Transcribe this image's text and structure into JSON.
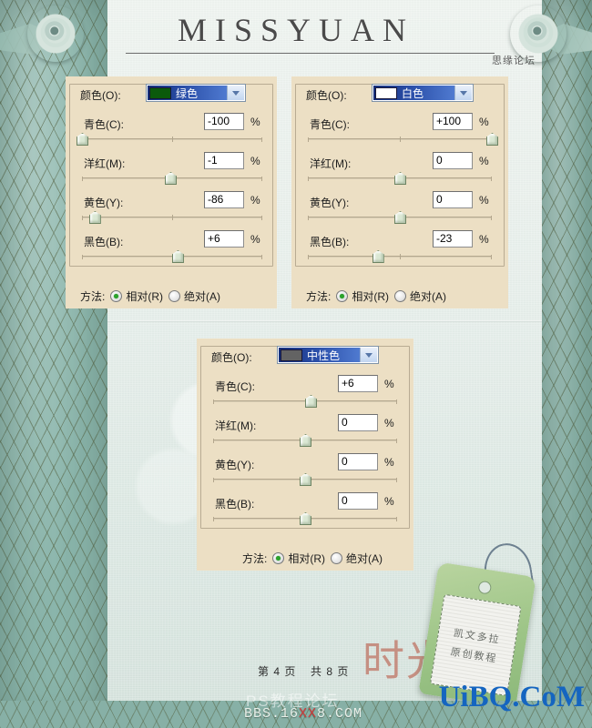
{
  "header": {
    "brand_title": "MISSYUAN",
    "brand_sub": "思缘论坛"
  },
  "panels": [
    {
      "id": "panel-green",
      "color_label": "颜色(O):",
      "selected_color": "绿色",
      "swatch_hex": "#0b5a0b",
      "channels": [
        {
          "label": "青色(C):",
          "value": "-100",
          "unit": "%",
          "slider_pct": 0
        },
        {
          "label": "洋红(M):",
          "value": "-1",
          "unit": "%",
          "slider_pct": 49
        },
        {
          "label": "黄色(Y):",
          "value": "-86",
          "unit": "%",
          "slider_pct": 7
        },
        {
          "label": "黑色(B):",
          "value": "+6",
          "unit": "%",
          "slider_pct": 53
        }
      ],
      "method_label": "方法:",
      "method_options": [
        {
          "label": "相对(R)",
          "selected": true
        },
        {
          "label": "绝对(A)",
          "selected": false
        }
      ]
    },
    {
      "id": "panel-white",
      "color_label": "颜色(O):",
      "selected_color": "白色",
      "swatch_hex": "#ffffff",
      "channels": [
        {
          "label": "青色(C):",
          "value": "+100",
          "unit": "%",
          "slider_pct": 100
        },
        {
          "label": "洋红(M):",
          "value": "0",
          "unit": "%",
          "slider_pct": 50
        },
        {
          "label": "黄色(Y):",
          "value": "0",
          "unit": "%",
          "slider_pct": 50
        },
        {
          "label": "黑色(B):",
          "value": "-23",
          "unit": "%",
          "slider_pct": 38
        }
      ],
      "method_label": "方法:",
      "method_options": [
        {
          "label": "相对(R)",
          "selected": true
        },
        {
          "label": "绝对(A)",
          "selected": false
        }
      ]
    },
    {
      "id": "panel-neutral",
      "color_label": "颜色(O):",
      "selected_color": "中性色",
      "swatch_hex": "#636363",
      "channels": [
        {
          "label": "青色(C):",
          "value": "+6",
          "unit": "%",
          "slider_pct": 53
        },
        {
          "label": "洋红(M):",
          "value": "0",
          "unit": "%",
          "slider_pct": 50
        },
        {
          "label": "黄色(Y):",
          "value": "0",
          "unit": "%",
          "slider_pct": 50
        },
        {
          "label": "黑色(B):",
          "value": "0",
          "unit": "%",
          "slider_pct": 50
        }
      ],
      "method_label": "方法:",
      "method_options": [
        {
          "label": "相对(R)",
          "selected": true
        },
        {
          "label": "绝对(A)",
          "selected": false
        }
      ]
    }
  ],
  "footer": {
    "page_current": "第 4 页",
    "page_total": "共 8 页",
    "shiguang": "时光。",
    "tag_line1": "凯文多拉",
    "tag_line2": "原创教程",
    "watermark_ps": "PS教程论坛",
    "watermark_bbs_a": "BBS.16",
    "watermark_bbs_xx": "XX",
    "watermark_bbs_b": "8.COM",
    "watermark_uibq": "UiBQ.CoM"
  },
  "colors": {
    "panel_bg": "#ecdfc4",
    "paper": "#e6eeea",
    "lattice": "#8ab5ab",
    "combo_highlight": "#2a4ea8",
    "radio_on": "#2ba32b",
    "accent_pink": "#c4897b",
    "watermark_blue": "#1565c0"
  }
}
